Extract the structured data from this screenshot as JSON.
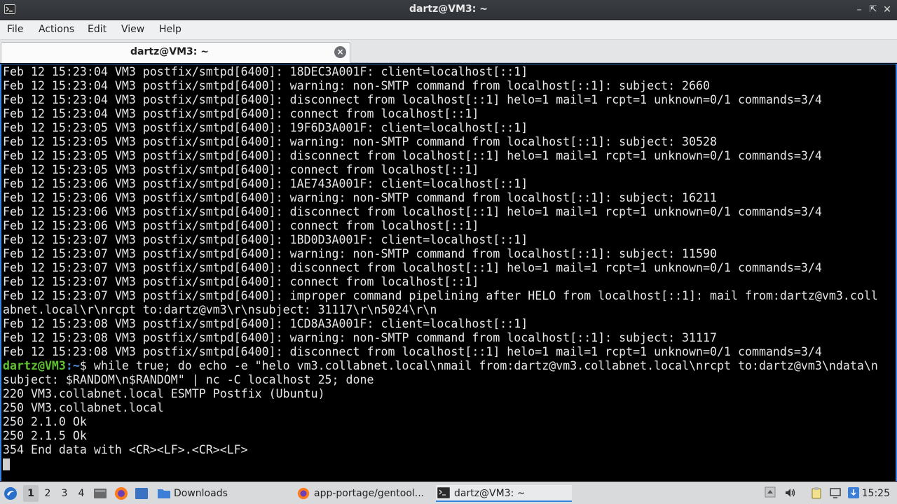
{
  "window": {
    "title": "dartz@VM3: ~"
  },
  "menu": [
    "File",
    "Actions",
    "Edit",
    "View",
    "Help"
  ],
  "tab": {
    "label": "dartz@VM3: ~"
  },
  "terminal": {
    "lines": [
      "Feb 12 15:23:04 VM3 postfix/smtpd[6400]: 18DEC3A001F: client=localhost[::1]",
      "Feb 12 15:23:04 VM3 postfix/smtpd[6400]: warning: non-SMTP command from localhost[::1]: subject: 2660",
      "Feb 12 15:23:04 VM3 postfix/smtpd[6400]: disconnect from localhost[::1] helo=1 mail=1 rcpt=1 unknown=0/1 commands=3/4",
      "Feb 12 15:23:04 VM3 postfix/smtpd[6400]: connect from localhost[::1]",
      "Feb 12 15:23:05 VM3 postfix/smtpd[6400]: 19F6D3A001F: client=localhost[::1]",
      "Feb 12 15:23:05 VM3 postfix/smtpd[6400]: warning: non-SMTP command from localhost[::1]: subject: 30528",
      "Feb 12 15:23:05 VM3 postfix/smtpd[6400]: disconnect from localhost[::1] helo=1 mail=1 rcpt=1 unknown=0/1 commands=3/4",
      "Feb 12 15:23:05 VM3 postfix/smtpd[6400]: connect from localhost[::1]",
      "Feb 12 15:23:06 VM3 postfix/smtpd[6400]: 1AE743A001F: client=localhost[::1]",
      "Feb 12 15:23:06 VM3 postfix/smtpd[6400]: warning: non-SMTP command from localhost[::1]: subject: 16211",
      "Feb 12 15:23:06 VM3 postfix/smtpd[6400]: disconnect from localhost[::1] helo=1 mail=1 rcpt=1 unknown=0/1 commands=3/4",
      "Feb 12 15:23:06 VM3 postfix/smtpd[6400]: connect from localhost[::1]",
      "Feb 12 15:23:07 VM3 postfix/smtpd[6400]: 1BD0D3A001F: client=localhost[::1]",
      "Feb 12 15:23:07 VM3 postfix/smtpd[6400]: warning: non-SMTP command from localhost[::1]: subject: 11590",
      "Feb 12 15:23:07 VM3 postfix/smtpd[6400]: disconnect from localhost[::1] helo=1 mail=1 rcpt=1 unknown=0/1 commands=3/4",
      "Feb 12 15:23:07 VM3 postfix/smtpd[6400]: connect from localhost[::1]",
      "Feb 12 15:23:07 VM3 postfix/smtpd[6400]: improper command pipelining after HELO from localhost[::1]: mail from:dartz@vm3.coll",
      "abnet.local\\r\\nrcpt to:dartz@vm3\\r\\nsubject: 31117\\r\\n5024\\r\\n",
      "Feb 12 15:23:08 VM3 postfix/smtpd[6400]: 1CD8A3A001F: client=localhost[::1]",
      "Feb 12 15:23:08 VM3 postfix/smtpd[6400]: warning: non-SMTP command from localhost[::1]: subject: 31117",
      "Feb 12 15:23:08 VM3 postfix/smtpd[6400]: disconnect from localhost[::1] helo=1 mail=1 rcpt=1 unknown=0/1 commands=3/4"
    ],
    "prompt": {
      "user_host": "dartz@VM3",
      "path": ":~",
      "symbol": "$",
      "command": " while true; do echo -e \"helo vm3.collabnet.local\\nmail from:dartz@vm3.collabnet.local\\nrcpt to:dartz@vm3\\ndata\\n",
      "command_cont": "subject: $RANDOM\\n$RANDOM\" | nc -C localhost 25; done"
    },
    "output": [
      "220 VM3.collabnet.local ESMTP Postfix (Ubuntu)",
      "250 VM3.collabnet.local",
      "250 2.1.0 Ok",
      "250 2.1.5 Ok",
      "354 End data with <CR><LF>.<CR><LF>"
    ]
  },
  "taskbar": {
    "workspaces": [
      "1",
      "2",
      "3",
      "4"
    ],
    "tasks": [
      {
        "label": "Downloads",
        "icon": "folder-icon"
      },
      {
        "label": "app-portage/gentool...",
        "icon": "firefox-icon"
      },
      {
        "label": "dartz@VM3: ~",
        "icon": "terminal-icon"
      }
    ],
    "clock": "15:25"
  },
  "colors": {
    "accent": "#3584e4",
    "prompt_user": "#5ec22e",
    "prompt_path": "#4a8fd8"
  }
}
